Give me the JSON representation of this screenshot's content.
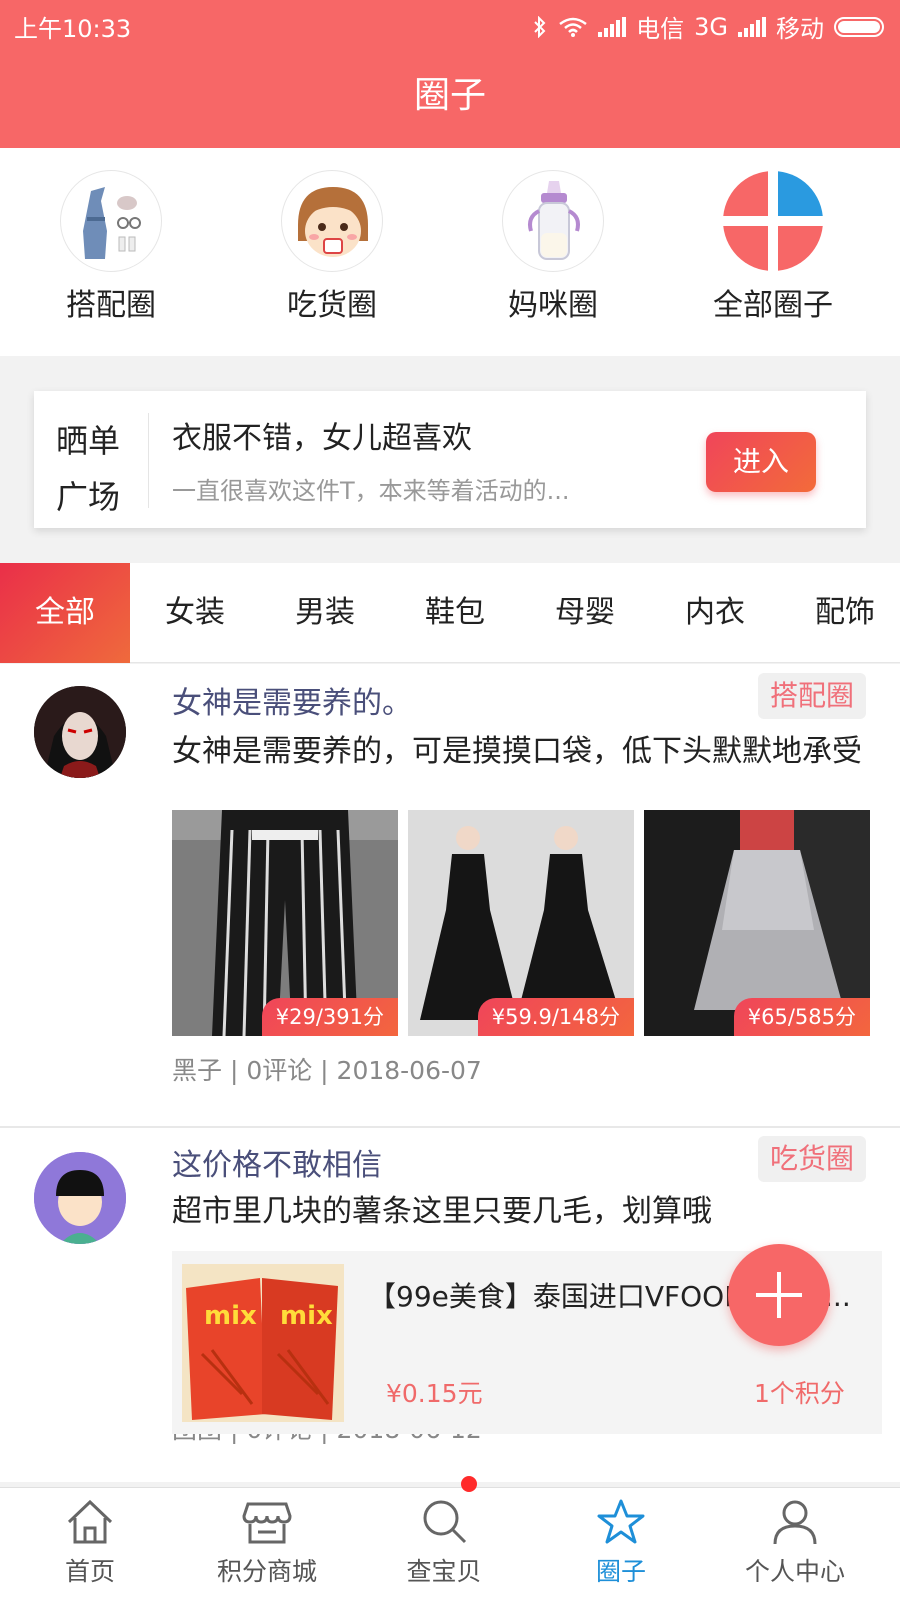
{
  "status_bar": {
    "time": "上午10:33",
    "carrier1": "电信",
    "network1": "3G",
    "carrier2": "移动"
  },
  "header": {
    "title": "圈子"
  },
  "circles": [
    {
      "label": "搭配圈",
      "icon": "dress-icon"
    },
    {
      "label": "吃货圈",
      "icon": "girl-eating-icon"
    },
    {
      "label": "妈咪圈",
      "icon": "baby-bottle-icon"
    },
    {
      "label": "全部圈子",
      "icon": "all-circles-icon"
    }
  ],
  "show_area": {
    "label_line1": "晒单",
    "label_line2": "广场",
    "title": "衣服不错，女儿超喜欢",
    "desc": "一直很喜欢这件T，本来等着活动的...",
    "enter": "进入"
  },
  "tabs": [
    "全部",
    "女装",
    "男装",
    "鞋包",
    "母婴",
    "内衣",
    "配饰"
  ],
  "active_tab": "全部",
  "posts": [
    {
      "title": "女神是需要养的。",
      "tag": "搭配圈",
      "text": "女神是需要养的，可是摸摸口袋，低下头默默地承受",
      "images": [
        {
          "price": "¥29/391分"
        },
        {
          "price": "¥59.9/148分"
        },
        {
          "price": "¥65/585分"
        }
      ],
      "meta": "黑子 | 0评论 | 2018-06-07"
    },
    {
      "title": "这价格不敢相信",
      "tag": "吃货圈",
      "text": "超市里几块的薯条这里只要几毛，划算哦",
      "product": {
        "title": "【99e美食】泰国进口VFOODS MIX...",
        "price": "¥0.15元",
        "points": "1个积分"
      },
      "meta": "团团 | 0评论 | 2018-06-12"
    }
  ],
  "bottom_nav": [
    {
      "label": "首页",
      "icon": "home-icon"
    },
    {
      "label": "积分商城",
      "icon": "store-icon"
    },
    {
      "label": "查宝贝",
      "icon": "search-icon"
    },
    {
      "label": "圈子",
      "icon": "star-icon"
    },
    {
      "label": "个人中心",
      "icon": "user-icon"
    }
  ],
  "colors": {
    "brand": "#f76767",
    "active_nav": "#1e8fd8",
    "tag_text": "#f0707a"
  }
}
